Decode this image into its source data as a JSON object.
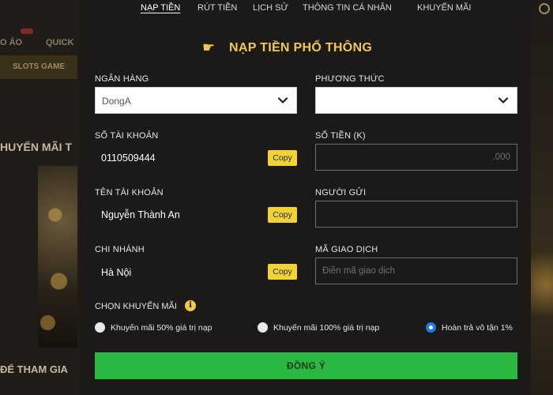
{
  "background": {
    "nav_left_1": "O ÁO",
    "nav_left_2": "QUICK",
    "slots": "SLOTS GAME",
    "promo_title": "HUYẾN MÃI T",
    "join_text": "ĐỂ THAM GIA"
  },
  "tabs": [
    {
      "label": "NẠP TIỀN",
      "active": true
    },
    {
      "label": "RÚT TIỀN"
    },
    {
      "label": "LỊCH SỬ"
    },
    {
      "label": "THÔNG TIN CÁ NHÂN"
    },
    {
      "label": "KHUYẾN MÃI"
    }
  ],
  "heading": {
    "icon": "pointing-hand-icon",
    "icon_glyph": "☛",
    "title": "NẠP TIỀN PHỔ THÔNG"
  },
  "form": {
    "bank": {
      "label": "NGÂN HÀNG",
      "selected": "DongA"
    },
    "method": {
      "label": "PHƯƠNG THỨC",
      "selected": ""
    },
    "account_number": {
      "label": "SỐ TÀI KHOẢN",
      "value": "0110509444"
    },
    "amount": {
      "label": "SỐ TIỀN (K)",
      "placeholder": ".000"
    },
    "account_name": {
      "label": "TÊN TÀI KHOẢN",
      "value": "Nguyễn Thành An"
    },
    "sender": {
      "label": "NGƯỜI GỬI",
      "placeholder": ""
    },
    "branch": {
      "label": "CHI NHÁNH",
      "value": "Hà Nội"
    },
    "transaction_code": {
      "label": "MÃ GIAO DỊCH",
      "placeholder": "Điền mã giao dịch"
    },
    "copy_label": "Copy"
  },
  "promotion": {
    "label": "CHỌN KHUYẾN MÃI",
    "info_glyph": "i",
    "options": [
      {
        "label": "Khuyến mãi 50% giá trị nạp",
        "checked": false
      },
      {
        "label": "Khuyến mãi 100% giá trị nạp",
        "checked": false
      },
      {
        "label": "Hoàn trả vô tận 1%",
        "checked": true
      }
    ]
  },
  "submit_label": "ĐỒNG Ý",
  "colors": {
    "accent": "#f2c94c",
    "copy_button": "#f2d237",
    "submit": "#2ab742",
    "radio_checked": "#1e7be8",
    "modal_bg": "#1b1a19"
  }
}
